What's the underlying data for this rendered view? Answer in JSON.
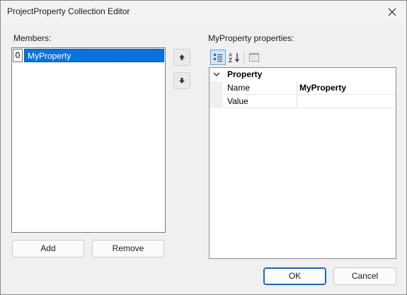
{
  "window": {
    "title": "ProjectProperty Collection Editor"
  },
  "members": {
    "label": "Members:",
    "items": [
      {
        "index": "0",
        "name": "MyProperty"
      }
    ]
  },
  "properties": {
    "label": "MyProperty properties:",
    "category": "Property",
    "rows": [
      {
        "name": "Name",
        "value": "MyProperty"
      },
      {
        "name": "Value",
        "value": ""
      }
    ]
  },
  "buttons": {
    "add": "Add",
    "remove": "Remove",
    "ok": "OK",
    "cancel": "Cancel"
  },
  "icons": {
    "close": "close-icon",
    "move_up": "arrow-up-icon",
    "move_down": "arrow-down-icon",
    "categorized": "categorized-icon",
    "alphabetical": "sort-alphabetical-icon",
    "property_pages": "property-pages-icon",
    "collapse": "chevron-down-icon"
  },
  "colors": {
    "selection": "#0a73d9",
    "accent": "#1f63c6"
  }
}
